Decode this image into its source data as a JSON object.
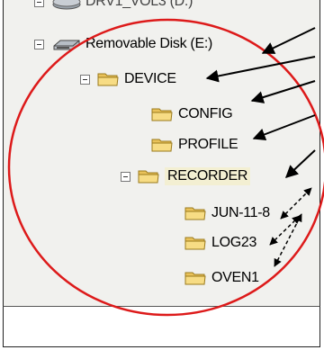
{
  "tree": {
    "top_item": {
      "label": "DRV1_VOL3 (D:)"
    },
    "disk_item": {
      "label": "Removable Disk (E:)"
    },
    "device": {
      "label": "DEVICE"
    },
    "config": {
      "label": "CONFIG"
    },
    "profile": {
      "label": "PROFILE"
    },
    "recorder": {
      "label": "RECORDER"
    },
    "jun": {
      "label": "JUN-11-8"
    },
    "log": {
      "label": "LOG23"
    },
    "oven": {
      "label": "OVEN1"
    }
  },
  "icons": {
    "folder": "folder-icon",
    "disk": "removable-disk-icon",
    "expand": "minus-box-icon"
  },
  "colors": {
    "highlight_circle": "#dd1a1a",
    "arrow": "#000000",
    "folder_fill": "#f4d36b",
    "selection": "#f3efd2"
  }
}
